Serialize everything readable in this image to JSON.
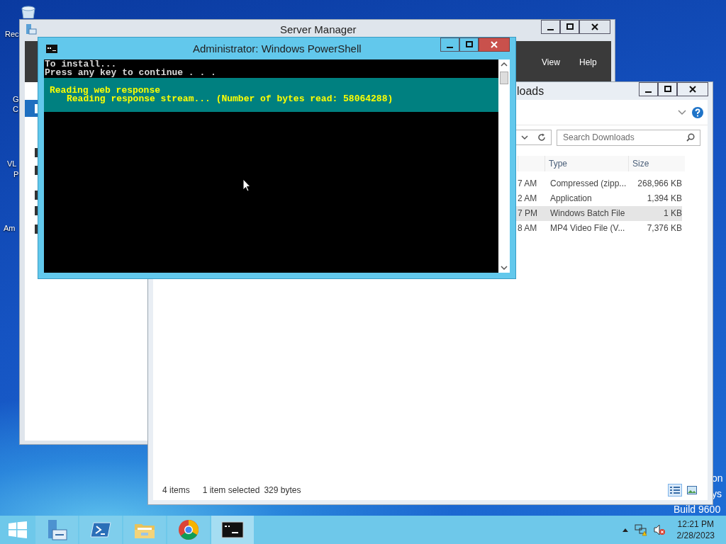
{
  "desktop": {
    "icons": [
      {
        "kind": "recycle-bin",
        "lines": [
          "Rec"
        ]
      },
      {
        "kind": "chrome",
        "lines": [
          "G",
          "C"
        ]
      },
      {
        "kind": "vlc",
        "lines": [
          "VL",
          "P"
        ]
      },
      {
        "kind": "amazon",
        "lines": [
          "Am"
        ]
      }
    ],
    "watermark": [
      "on",
      "ys",
      "Build 9600"
    ]
  },
  "server_manager": {
    "title": "Server Manager",
    "menu": [
      "View",
      "Help"
    ],
    "nav_items": [
      {
        "selected": true
      },
      {
        "selected": false
      },
      {
        "selected": false
      },
      {
        "selected": false
      },
      {
        "selected": false
      },
      {
        "selected": false
      }
    ]
  },
  "explorer": {
    "title": "loads",
    "search": {
      "placeholder": "Search Downloads"
    },
    "columns": [
      "Type",
      "Size"
    ],
    "rows": [
      {
        "modified": "7 AM",
        "type": "Compressed (zipp...",
        "size": "268,966 KB",
        "selected": false
      },
      {
        "modified": "2 AM",
        "type": "Application",
        "size": "1,394 KB",
        "selected": false
      },
      {
        "modified": "7 PM",
        "type": "Windows Batch File",
        "size": "1 KB",
        "selected": true
      },
      {
        "modified": "8 AM",
        "type": "MP4 Video File (V...",
        "size": "7,376 KB",
        "selected": false
      }
    ],
    "status": {
      "count": "4 items",
      "selection": "1 item selected",
      "size": "329 bytes"
    },
    "view_modes": [
      {
        "kind": "details",
        "selected": true
      },
      {
        "kind": "tiles",
        "selected": false
      }
    ]
  },
  "powershell": {
    "title": "Administrator: Windows PowerShell",
    "lines": [
      "To install...",
      "Press any key to continue . . ."
    ],
    "progress": {
      "activity": "Reading web response",
      "status": "Reading response stream... (Number of bytes read: 58064288)"
    }
  },
  "taskbar": {
    "buttons": [
      {
        "kind": "server-manager",
        "selected": false
      },
      {
        "kind": "powershell",
        "selected": false
      },
      {
        "kind": "explorer",
        "selected": false
      },
      {
        "kind": "chrome",
        "selected": false
      },
      {
        "kind": "console",
        "selected": true
      }
    ],
    "clock": {
      "time": "12:21 PM",
      "date": "2/28/2023"
    }
  }
}
